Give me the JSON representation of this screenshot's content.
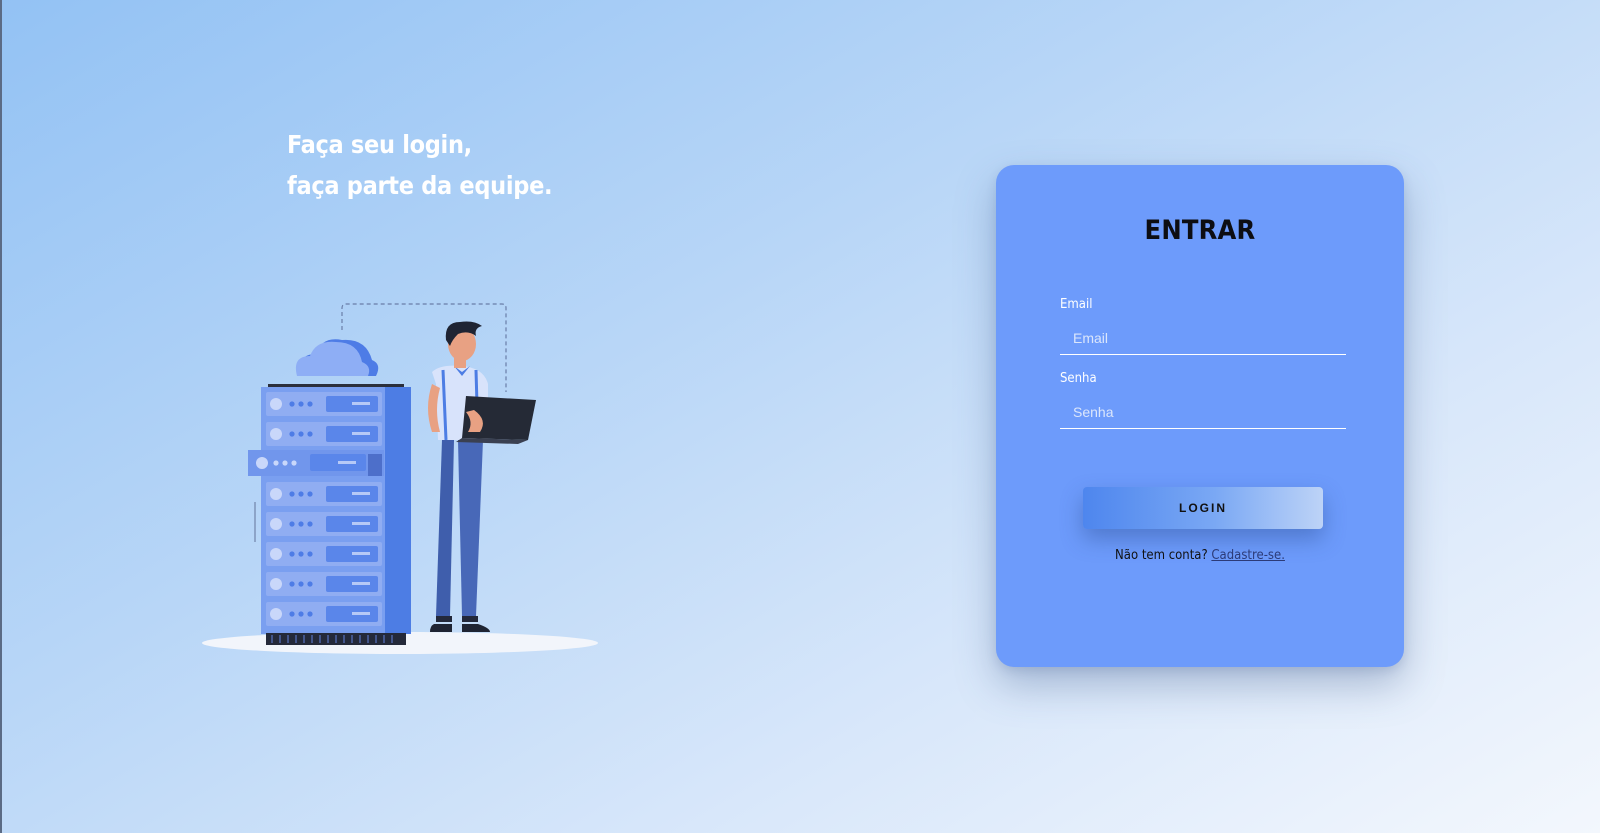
{
  "hero": {
    "line1": "Faça seu login,",
    "line2": "faça parte da equipe."
  },
  "illustration": {
    "icon": "server-person-illustration"
  },
  "login_card": {
    "title": "ENTRAR",
    "email": {
      "label": "Email",
      "placeholder": "Email",
      "value": ""
    },
    "password": {
      "label": "Senha",
      "placeholder": "Senha",
      "value": ""
    },
    "submit_label": "LOGIN",
    "signup_prompt": "Não tem conta?",
    "signup_link": "Cadastre-se."
  },
  "colors": {
    "card": "#6d9bfb",
    "accent": "#4e86ee",
    "link": "#2c3b78"
  }
}
